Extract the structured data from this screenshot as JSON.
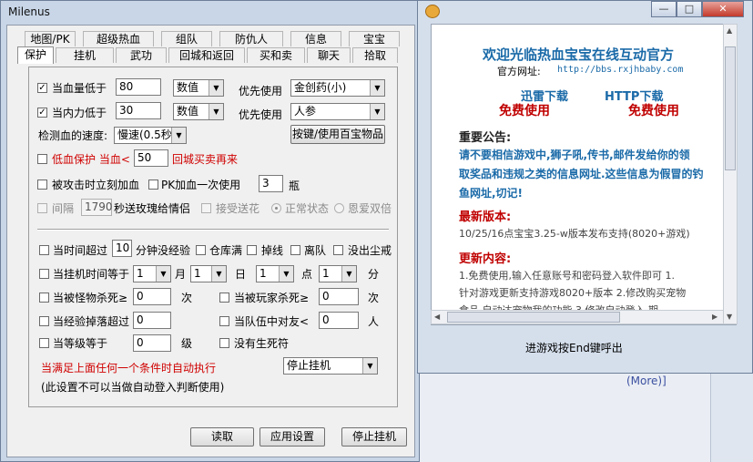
{
  "main_window": {
    "title": "Milenus",
    "tabs_row1": [
      "地图/PK",
      "超级热血",
      "组队",
      "防仇人",
      "信息",
      "宝宝"
    ],
    "tabs_row2": [
      "保护",
      "挂机",
      "武功",
      "回城和返回",
      "买和卖",
      "聊天",
      "拾取"
    ],
    "protect": {
      "hp_low_label": "当血量低于",
      "hp_low_value": "80",
      "hp_unit": "数值",
      "hp_prefer_label": "优先使用",
      "hp_item": "金创药(小)",
      "mp_low_label": "当内力低于",
      "mp_low_value": "30",
      "mp_unit": "数值",
      "mp_prefer_label": "优先使用",
      "mp_item": "人参",
      "check_speed_label": "检测血的速度:",
      "check_speed_value": "慢速(0.5秒)",
      "hotkey_button": "按键/使用百宝物品",
      "low_hp_protect_label": "低血保护 当血<",
      "low_hp_protect_value": "50",
      "low_hp_protect_suffix": "回城买卖再来",
      "hit_add_label": "被攻击时立刻加血",
      "pk_add_label": "PK加血一次使用",
      "pk_add_value": "3",
      "pk_add_unit": "瓶",
      "interval_label": "间隔",
      "interval_value": "1790",
      "rose_label": "秒送玫瑰给情侣",
      "accept_flower_label": "接受送花",
      "radio_normal": "正常状态",
      "radio_love": "恩爱双倍"
    },
    "stop": {
      "time_exceed_label": "当时间超过",
      "time_exceed_value": "10",
      "no_exp_label": "分钟没经验",
      "warehouse_full_label": "仓库满",
      "disconnect_label": "掉线",
      "leave_team_label": "离队",
      "no_dust_label": "没出尘戒",
      "hang_time_label": "当挂机时间等于",
      "month_value": "1",
      "month_label": "月",
      "day_value": "1",
      "day_label": "日",
      "hour_value": "1",
      "hour_label": "点",
      "minute_value": "1",
      "minute_label": "分",
      "monster_kill_label": "当被怪物杀死≥",
      "monster_kill_value": "0",
      "monster_kill_unit": "次",
      "player_kill_label": "当被玩家杀死≥",
      "player_kill_value": "0",
      "player_kill_unit": "次",
      "exp_drop_label": "当经验掉落超过",
      "exp_drop_value": "0",
      "team_hostile_label": "当队伍中对友<",
      "team_hostile_value": "0",
      "team_hostile_unit": "人",
      "level_label": "当等级等于",
      "level_value": "0",
      "level_unit": "级",
      "no_revive_label": "没有生死符",
      "auto_exec_text": "当满足上面任何一个条件时自动执行",
      "action_value": "停止挂机",
      "note_text": "(此设置不可以当做自动登入判断使用)"
    },
    "buttons": {
      "read": "读取",
      "apply": "应用设置",
      "stop": "停止挂机"
    }
  },
  "popup": {
    "window_buttons": [
      "—",
      "□",
      "✕"
    ],
    "welcome": "欢迎光临热血宝宝在线互动官方",
    "site_label": "官方网址:",
    "site_url": "http://bbs.rxjhbaby.com",
    "xunlei": "迅雷下载",
    "http": "HTTP下载",
    "free1": "免费使用",
    "free2": "免费使用",
    "notice_title": "重要公告:",
    "notice_lines": [
      "请不要相信游戏中,狮子吼,传书,邮件发给你的领",
      "取奖品和违规之类的信息网址.这些信息为假冒的钓",
      "鱼网址,切记!"
    ],
    "latest_title": "最新版本:",
    "latest_text": "10/25/16点宝宝3.25-w版本发布支持(8020+游戏)",
    "update_title": "更新内容:",
    "update_lines": [
      "1.免费使用,输入任意账号和密码登入软件即可 1.",
      "针对游戏更新支持游戏8020+版本 2.修改购买宠物",
      "食品 自动达宠物我的功能  3.修改自动登入 期"
    ],
    "hint": "进游戏按End键呼出"
  },
  "background": {
    "more_link": "(More)]"
  },
  "colors": {
    "title_blue": "#1a6aa8",
    "red": "#d00000",
    "dark_red": "#c00000"
  }
}
